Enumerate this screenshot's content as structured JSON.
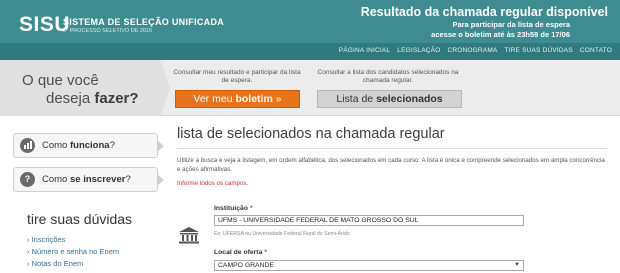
{
  "header": {
    "logo": "SISU",
    "logo_title": "SISTEMA DE SELEÇÃO UNIFICADA",
    "logo_subtitle": "2º PROCESSO SELETIVO DE 2016",
    "headline": "Resultado da chamada regular disponível",
    "line2": "Para participar da lista de espera",
    "line3": "acesse o boletim até às 23h59 de 17/06"
  },
  "nav": {
    "items": [
      "PÁGINA INICIAL",
      "LEGISLAÇÃO",
      "CRONOGRAMA",
      "TIRE SUAS DÚVIDAS",
      "CONTATO"
    ]
  },
  "promo": {
    "question_line1": "O que você",
    "question_line2_pre": "deseja ",
    "question_line2_bold": "fazer?",
    "desc_boletim": "Consultar meu resultado e participar da lista de espera.",
    "desc_selecionados": "Consultar a lista dos candidatos selecionados na chamada regular.",
    "btn_boletim_pre": "Ver meu ",
    "btn_boletim_bold": "boletim",
    "btn_boletim_suffix": " »",
    "btn_selecionados_pre": "Lista de ",
    "btn_selecionados_bold": "selecionados"
  },
  "sidebar": {
    "how_works_pre": "Como ",
    "how_works_bold": "funciona",
    "how_works_suffix": "?",
    "how_register_pre": "Como ",
    "how_register_bold": "se inscrever",
    "how_register_suffix": "?",
    "doubts_title": "tire suas dúvidas",
    "doubts_items": [
      "Inscrições",
      "Número e senha no Enem",
      "Notas do Enem"
    ]
  },
  "main": {
    "title": "lista de selecionados na chamada regular",
    "intro": "Utilize a busca e veja a listagem, em ordem alfabética, dos selecionados em cada curso. A lista é única e compreende selecionados em ampla concorrência e ações afirmativas.",
    "required_note": "Informe todos os campos.",
    "institution_label": "Instituição",
    "institution_value": "UFMS - UNIVERSIDADE FEDERAL DE MATO GROSSO DO SUL",
    "institution_hint": "Ex: UFERSA ou Universidade Federal Rural do Semi-Árido",
    "location_label": "Local de oferta",
    "location_value": "CAMPO GRANDE",
    "required_mark": "*"
  },
  "colors": {
    "header": "#3e8c8f",
    "nav": "#2f7a7d",
    "orange_button": "#e8731a",
    "required": "#c0392b"
  }
}
